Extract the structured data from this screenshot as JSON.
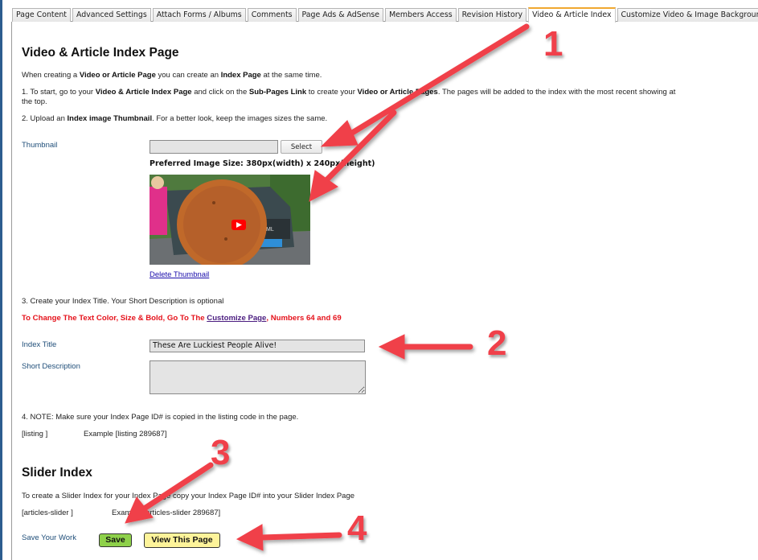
{
  "tabs": [
    {
      "label": "Page Content",
      "active": false
    },
    {
      "label": "Advanced Settings",
      "active": false
    },
    {
      "label": "Attach Forms / Albums",
      "active": false
    },
    {
      "label": "Comments",
      "active": false
    },
    {
      "label": "Page Ads & AdSense",
      "active": false
    },
    {
      "label": "Members Access",
      "active": false
    },
    {
      "label": "Revision History",
      "active": false
    },
    {
      "label": "Video & Article Index",
      "active": true
    },
    {
      "label": "Customize Video & Image Backgrounds",
      "active": false
    }
  ],
  "section1": {
    "title": "Video & Article Index Page",
    "intro": {
      "a": "When creating a ",
      "b": "Video or Article Page",
      "c": " you can create an ",
      "d": "Index Page",
      "e": " at the same time."
    },
    "step1": {
      "a": "1. To start, go to your ",
      "b": "Video & Article Index Page",
      "c": " and click on the ",
      "d": "Sub-Pages Link",
      "e": " to create your ",
      "f": "Video or Article Pages",
      "g": ". The pages will be added to the index with the most recent showing at",
      "h": "the top."
    },
    "step2": {
      "a": "2. Upload an ",
      "b": "Index image Thumbnail",
      "c": ". For a better look, keep the images sizes the same."
    },
    "thumbnail_label": "Thumbnail",
    "thumbnail_input_value": "",
    "select_button": "Select",
    "preferred_size": "Preferred Image Size: 380px(width) x 240px(height)",
    "thumbnail_image_alt": "Video thumbnail: giant rusty saw blade in front of a car with a woman running",
    "delete_thumbnail": "Delete Thumbnail",
    "step3": "3. Create your Index Title. Your Short Description is optional",
    "red_note": {
      "a": "To Change The Text Color, Size & Bold, Go To The ",
      "link": "Customize Page",
      "b": ", Numbers 64 and 69"
    },
    "index_title_label": "Index Title",
    "index_title_value": "These Are Luckiest People Alive!",
    "short_description_label": "Short Description",
    "short_description_value": "",
    "step4": "4. NOTE: Make sure your Index Page ID# is copied in the listing code in the page.",
    "listing_code": "[listing ]",
    "listing_example": "Example [listing 289687]"
  },
  "section2": {
    "title": "Slider Index",
    "desc": "To create a Slider Index for your Index Page copy your Index Page ID# into your Slider Index Page",
    "slider_code": "[articles-slider ]",
    "slider_example": "Example [articles-slider 289687]",
    "save_label": "Save Your Work",
    "save_button": "Save",
    "view_button": "View This Page"
  },
  "annotations": {
    "n1": "1",
    "n2": "2",
    "n3": "3",
    "n4": "4",
    "arrow_color": "#f0404a"
  },
  "colors": {
    "accent_tab": "#f0a830",
    "label_blue": "#1f4e79",
    "warning_red": "#e5121b",
    "save_green": "#8ed14a",
    "view_yellow": "#fdf39a"
  }
}
